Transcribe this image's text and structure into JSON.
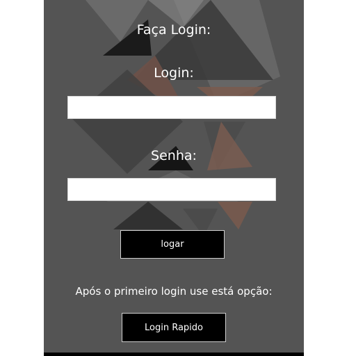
{
  "form": {
    "title": "Faça Login:",
    "login_label": "Login:",
    "login_value": "",
    "password_label": "Senha:",
    "password_value": "",
    "submit_label": "logar"
  },
  "quick_login": {
    "hint": "Após o primeiro login use está opção:",
    "button_label": "Login Rapido"
  },
  "colors": {
    "background": "#545454",
    "button": "#000000",
    "text": "#ffffff"
  }
}
